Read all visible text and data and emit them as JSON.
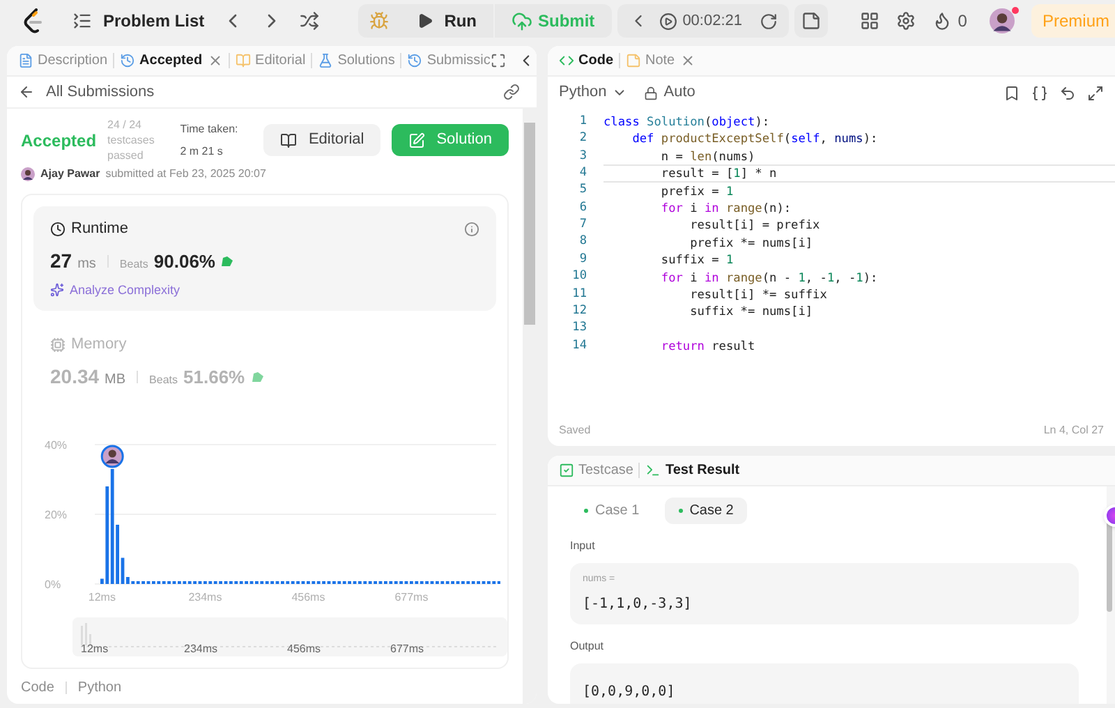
{
  "topbar": {
    "problem_list": "Problem List",
    "run": "Run",
    "submit": "Submit",
    "timer": "00:02:21",
    "streak": "0",
    "premium": "Premium",
    "notification_dot": true
  },
  "left_tabs": [
    {
      "label": "Description",
      "selected": false,
      "closable": false
    },
    {
      "label": "Accepted",
      "selected": true,
      "closable": true
    },
    {
      "label": "Editorial",
      "selected": false,
      "closable": false
    },
    {
      "label": "Solutions",
      "selected": false,
      "closable": false
    },
    {
      "label": "Submissic",
      "selected": false,
      "closable": false
    }
  ],
  "back_link": "All Submissions",
  "result": {
    "status": "Accepted",
    "testcases": "24 / 24 testcases passed",
    "time_taken": "Time taken: 2 m 21 s",
    "editorial_button": "Editorial",
    "solution_button": "Solution",
    "author": "Ajay Pawar",
    "submitted": "submitted at Feb 23, 2025 20:07"
  },
  "metrics": [
    {
      "kind": "runtime",
      "title": "Runtime",
      "value": "27",
      "unit": "ms",
      "beats_label": "Beats",
      "beats": "90.06%",
      "selected": true,
      "link": "Analyze Complexity"
    },
    {
      "kind": "memory",
      "title": "Memory",
      "value": "20.34",
      "unit": "MB",
      "beats_label": "Beats",
      "beats": "51.66%",
      "selected": false
    }
  ],
  "chart_data": {
    "type": "bar",
    "ylim": [
      0,
      40
    ],
    "yticks": [
      {
        "value": 0,
        "label": "0%"
      },
      {
        "value": 20,
        "label": "20%"
      },
      {
        "value": 40,
        "label": "40%"
      }
    ],
    "categories": [
      "12ms",
      null,
      null,
      null,
      null,
      null,
      null,
      null,
      null,
      null,
      null,
      null,
      null,
      null,
      null,
      null,
      null,
      null,
      null,
      null,
      "234ms",
      null,
      null,
      null,
      null,
      null,
      null,
      null,
      null,
      null,
      null,
      null,
      null,
      null,
      null,
      null,
      null,
      null,
      null,
      null,
      "456ms",
      null,
      null,
      null,
      null,
      null,
      null,
      null,
      null,
      null,
      null,
      null,
      null,
      null,
      null,
      null,
      null,
      null,
      null,
      null,
      "677ms",
      null,
      null,
      null,
      null,
      null,
      null,
      null,
      null,
      null,
      null,
      null,
      null,
      null,
      null,
      null,
      null,
      null
    ],
    "values": [
      1.5,
      28,
      33,
      17,
      7.5,
      2,
      0.8,
      0.8,
      0.8,
      0.8,
      0.8,
      0.8,
      0.8,
      0.8,
      0.8,
      0.8,
      0.8,
      0.8,
      0.8,
      0.8,
      0.8,
      0.8,
      0.8,
      0.8,
      0.8,
      0.8,
      0.8,
      0.8,
      0.8,
      0.8,
      0.8,
      0.8,
      0.8,
      0.8,
      0.8,
      0.8,
      0.8,
      0.8,
      0.8,
      0.8,
      0.8,
      0.8,
      0.8,
      0.8,
      0.8,
      0.8,
      0.8,
      0.8,
      0.8,
      0.8,
      0.8,
      0.8,
      0.8,
      0.8,
      0.8,
      0.8,
      0.8,
      0.8,
      0.8,
      0.8,
      0.8,
      0.8,
      0.8,
      0.8,
      0.8,
      0.8,
      0.8,
      0.8,
      0.8,
      0.8,
      0.8,
      0.8,
      0.8,
      0.8,
      0.8,
      0.8,
      0.8,
      0.8
    ]
  },
  "navigator_labels": [
    "12ms",
    "234ms",
    "456ms",
    "677ms"
  ],
  "left_footer": {
    "label": "Code",
    "language": "Python"
  },
  "right_tabs": [
    {
      "label": "Code",
      "selected": true,
      "closable": false
    },
    {
      "label": "Note",
      "selected": false,
      "closable": true
    }
  ],
  "editor": {
    "language": "Python",
    "mode": "Auto",
    "status": "Saved",
    "cursor": "Ln 4, Col 27",
    "lines": [
      {
        "number": "1",
        "current": false,
        "tokens": [
          {
            "t": "class ",
            "kind": "kw"
          },
          {
            "t": "Solution",
            "kind": "cls"
          },
          {
            "t": "(",
            "kind": "plain"
          },
          {
            "t": "object",
            "kind": "kw"
          },
          {
            "t": "):",
            "kind": "plain"
          }
        ]
      },
      {
        "number": "2",
        "current": false,
        "tokens": [
          {
            "t": "    def ",
            "kind": "kw"
          },
          {
            "t": "productExceptSelf",
            "kind": "fn"
          },
          {
            "t": "(",
            "kind": "plain"
          },
          {
            "t": "self",
            "kind": "kw"
          },
          {
            "t": ", ",
            "kind": "plain"
          },
          {
            "t": "nums",
            "kind": "var"
          },
          {
            "t": "):",
            "kind": "plain"
          }
        ]
      },
      {
        "number": "3",
        "current": false,
        "tokens": [
          {
            "t": "        n = ",
            "kind": "plain"
          },
          {
            "t": "len",
            "kind": "fn"
          },
          {
            "t": "(nums)",
            "kind": "plain"
          }
        ]
      },
      {
        "number": "4",
        "current": true,
        "tokens": [
          {
            "t": "        result = [",
            "kind": "plain"
          },
          {
            "t": "1",
            "kind": "num"
          },
          {
            "t": "] * n",
            "kind": "plain"
          }
        ]
      },
      {
        "number": "5",
        "current": false,
        "tokens": [
          {
            "t": "        prefix = ",
            "kind": "plain"
          },
          {
            "t": "1",
            "kind": "num"
          }
        ]
      },
      {
        "number": "6",
        "current": false,
        "tokens": [
          {
            "t": "        for",
            "kind": "ctrl"
          },
          {
            "t": " i ",
            "kind": "plain"
          },
          {
            "t": "in",
            "kind": "ctrl"
          },
          {
            "t": " range",
            "kind": "fn"
          },
          {
            "t": "(n):",
            "kind": "plain"
          }
        ]
      },
      {
        "number": "7",
        "current": false,
        "tokens": [
          {
            "t": "            result[i] = prefix",
            "kind": "plain"
          }
        ]
      },
      {
        "number": "8",
        "current": false,
        "tokens": [
          {
            "t": "            prefix *= nums[i]",
            "kind": "plain"
          }
        ]
      },
      {
        "number": "9",
        "current": false,
        "tokens": [
          {
            "t": "        suffix = ",
            "kind": "plain"
          },
          {
            "t": "1",
            "kind": "num"
          }
        ]
      },
      {
        "number": "10",
        "current": false,
        "tokens": [
          {
            "t": "        for",
            "kind": "ctrl"
          },
          {
            "t": " i ",
            "kind": "plain"
          },
          {
            "t": "in",
            "kind": "ctrl"
          },
          {
            "t": " range",
            "kind": "fn"
          },
          {
            "t": "(n - ",
            "kind": "plain"
          },
          {
            "t": "1",
            "kind": "num"
          },
          {
            "t": ", -",
            "kind": "plain"
          },
          {
            "t": "1",
            "kind": "num"
          },
          {
            "t": ", -",
            "kind": "plain"
          },
          {
            "t": "1",
            "kind": "num"
          },
          {
            "t": "):",
            "kind": "plain"
          }
        ]
      },
      {
        "number": "11",
        "current": false,
        "tokens": [
          {
            "t": "            result[i] *= suffix",
            "kind": "plain"
          }
        ]
      },
      {
        "number": "12",
        "current": false,
        "tokens": [
          {
            "t": "            suffix *= nums[i]",
            "kind": "plain"
          }
        ]
      },
      {
        "number": "13",
        "current": false
      },
      {
        "number": "14",
        "current": false,
        "tokens": [
          {
            "t": "        return",
            "kind": "ctrl"
          },
          {
            "t": " result",
            "kind": "plain"
          }
        ]
      }
    ]
  },
  "bottom_tabs": [
    {
      "label": "Testcase",
      "selected": false
    },
    {
      "label": "Test Result",
      "selected": true
    }
  ],
  "cases": [
    {
      "label": "Case 1",
      "selected": false
    },
    {
      "label": "Case 2",
      "selected": true
    }
  ],
  "input": {
    "label": "Input",
    "name": "nums =",
    "value": "[-1,1,0,-3,3]"
  },
  "output": {
    "label": "Output",
    "value": "[0,0,9,0,0]"
  }
}
